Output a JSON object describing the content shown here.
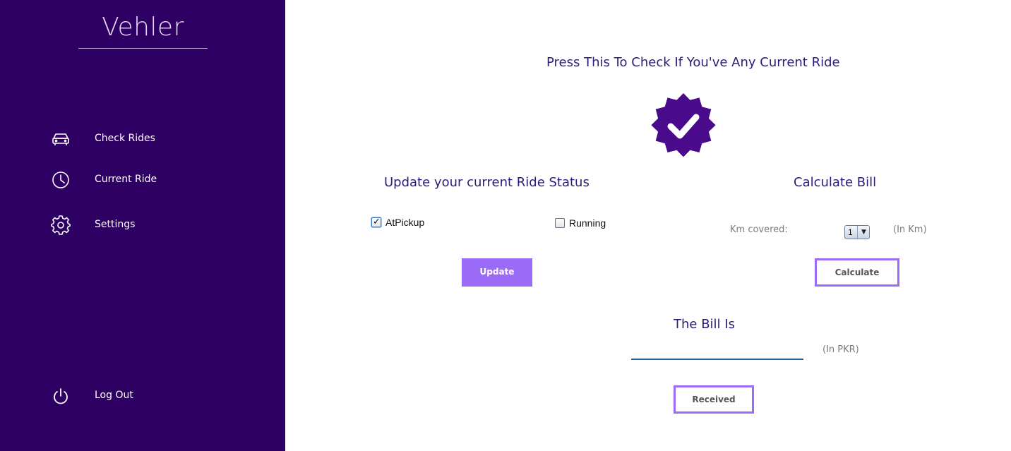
{
  "app": {
    "title": "Vehler"
  },
  "sidebar": {
    "items": [
      {
        "label": "Check Rides",
        "icon": "car-icon"
      },
      {
        "label": "Current Ride",
        "icon": "clock-icon"
      },
      {
        "label": "Settings",
        "icon": "gear-icon"
      }
    ],
    "logout": {
      "label": "Log Out",
      "icon": "power-icon"
    }
  },
  "main": {
    "check_heading": "Press This To Check If You've Any Current Ride",
    "check_icon": "verified-badge-icon",
    "status": {
      "heading": "Update your current Ride Status",
      "options": [
        {
          "label": "AtPickup",
          "checked": true
        },
        {
          "label": "Running",
          "checked": false
        }
      ],
      "update_label": "Update"
    },
    "bill": {
      "heading": "Calculate Bill",
      "km_label": "Km covered:",
      "km_value": "1",
      "km_unit": "(In Km)",
      "calculate_label": "Calculate",
      "result_heading": "The Bill Is",
      "result_value": "",
      "currency_unit": "(In PKR)",
      "received_label": "Received"
    }
  },
  "colors": {
    "sidebar_bg": "#2e0063",
    "accent": "#9b6bf7",
    "badge": "#4a0a8c",
    "heading": "#2e1a7a"
  }
}
